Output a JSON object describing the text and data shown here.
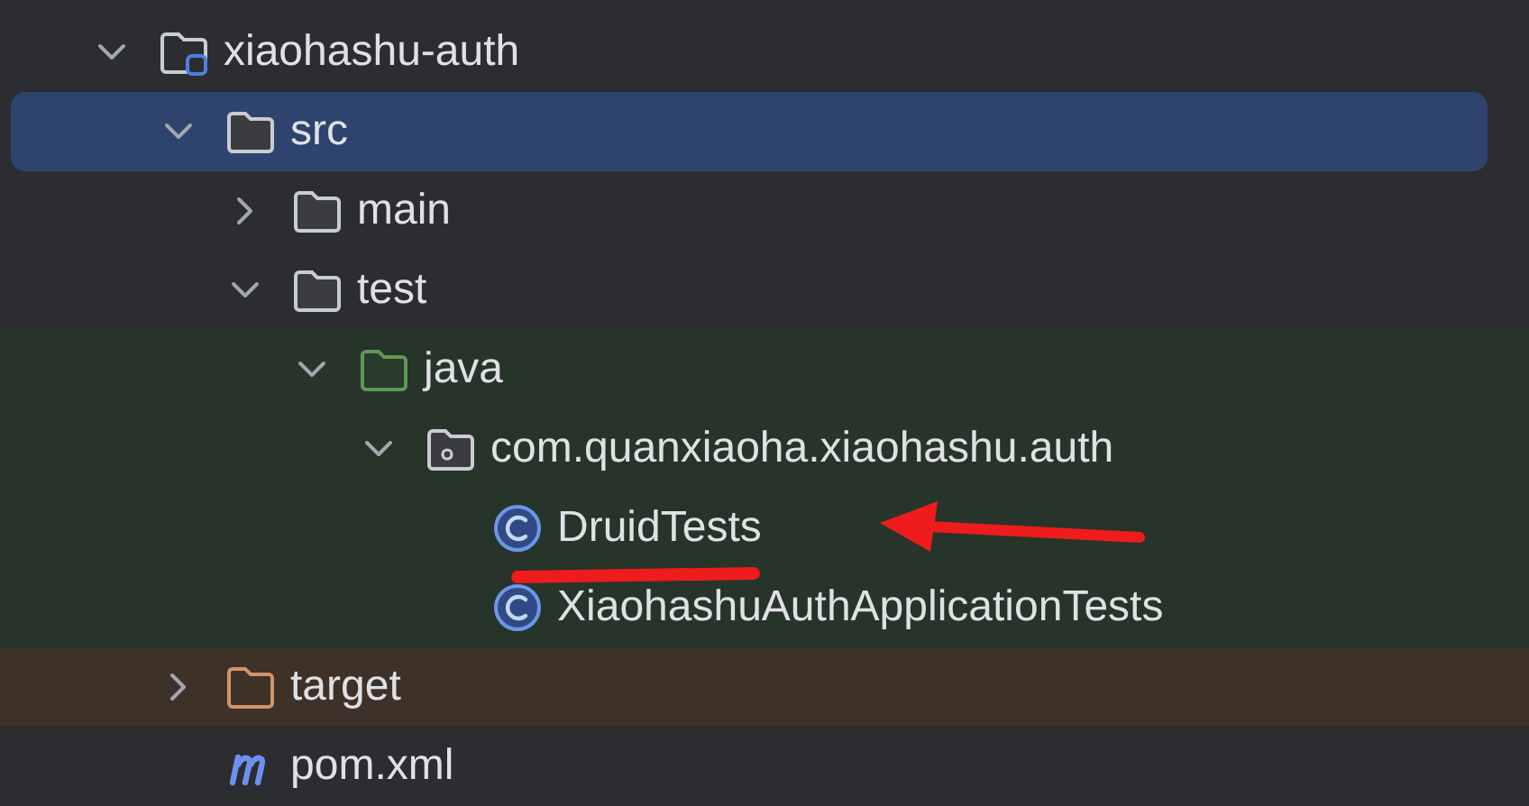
{
  "tree": [
    {
      "name": "xiaohashu-auth",
      "kind": "module",
      "expanded": true,
      "selected": false,
      "children": [
        {
          "name": "src",
          "kind": "folder",
          "expanded": true,
          "selected": true,
          "children": [
            {
              "name": "main",
              "kind": "folder",
              "expanded": false,
              "selected": false
            },
            {
              "name": "test",
              "kind": "folder",
              "expanded": true,
              "selected": false,
              "children": [
                {
                  "name": "java",
                  "kind": "test-root",
                  "expanded": true,
                  "selected": false,
                  "children": [
                    {
                      "name": "com.quanxiaoha.xiaohashu.auth",
                      "kind": "package",
                      "expanded": true,
                      "selected": false,
                      "children": [
                        {
                          "name": "DruidTests",
                          "kind": "class",
                          "selected": false
                        },
                        {
                          "name": "XiaohashuAuthApplicationTests",
                          "kind": "class",
                          "selected": false
                        }
                      ]
                    }
                  ]
                }
              ]
            }
          ]
        },
        {
          "name": "target",
          "kind": "excluded",
          "expanded": false,
          "selected": false
        },
        {
          "name": "pom.xml",
          "kind": "maven",
          "selected": false
        }
      ]
    }
  ]
}
